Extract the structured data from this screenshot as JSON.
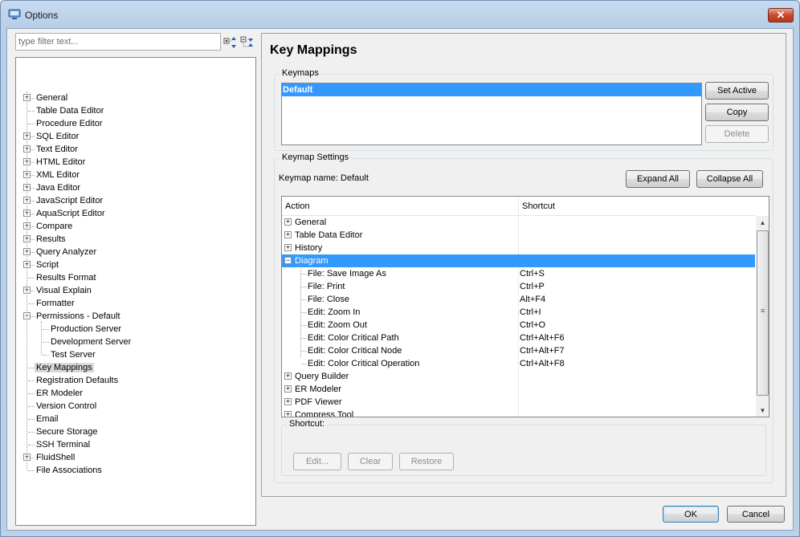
{
  "window": {
    "title": "Options"
  },
  "filter": {
    "placeholder": "type filter text..."
  },
  "tree": {
    "items": [
      {
        "label": "General",
        "expander": "+"
      },
      {
        "label": "Table Data Editor",
        "expander": ""
      },
      {
        "label": "Procedure Editor",
        "expander": ""
      },
      {
        "label": "SQL Editor",
        "expander": "+"
      },
      {
        "label": "Text Editor",
        "expander": "+"
      },
      {
        "label": "HTML Editor",
        "expander": "+"
      },
      {
        "label": "XML Editor",
        "expander": "+"
      },
      {
        "label": "Java Editor",
        "expander": "+"
      },
      {
        "label": "JavaScript Editor",
        "expander": "+"
      },
      {
        "label": "AquaScript Editor",
        "expander": "+"
      },
      {
        "label": "Compare",
        "expander": "+"
      },
      {
        "label": "Results",
        "expander": "+"
      },
      {
        "label": "Query Analyzer",
        "expander": "+"
      },
      {
        "label": "Script",
        "expander": "+"
      },
      {
        "label": "Results Format",
        "expander": ""
      },
      {
        "label": "Visual Explain",
        "expander": "+"
      },
      {
        "label": "Formatter",
        "expander": ""
      },
      {
        "label": "Permissions - Default",
        "expander": "−"
      },
      {
        "label": "Production Server",
        "expander": "",
        "child": true
      },
      {
        "label": "Development Server",
        "expander": "",
        "child": true
      },
      {
        "label": "Test Server",
        "expander": "",
        "child": true
      },
      {
        "label": "Key Mappings",
        "expander": "",
        "selected": true
      },
      {
        "label": "Registration Defaults",
        "expander": ""
      },
      {
        "label": "ER Modeler",
        "expander": ""
      },
      {
        "label": "Version Control",
        "expander": ""
      },
      {
        "label": "Email",
        "expander": ""
      },
      {
        "label": "Secure Storage",
        "expander": ""
      },
      {
        "label": "SSH Terminal",
        "expander": ""
      },
      {
        "label": "FluidShell",
        "expander": "+"
      },
      {
        "label": "File Associations",
        "expander": ""
      }
    ]
  },
  "page": {
    "title": "Key Mappings"
  },
  "keymaps": {
    "legend": "Keymaps",
    "selected": "Default",
    "set_active_label": "Set Active",
    "copy_label": "Copy",
    "delete_label": "Delete"
  },
  "settings": {
    "legend": "Keymap Settings",
    "keymap_name_text": "Keymap name: Default",
    "expand_all_label": "Expand All",
    "collapse_all_label": "Collapse All",
    "columns": {
      "action": "Action",
      "shortcut": "Shortcut"
    },
    "rows": [
      {
        "action": "General",
        "shortcut": "",
        "level": 0,
        "expander": "+"
      },
      {
        "action": "Table Data Editor",
        "shortcut": "",
        "level": 0,
        "expander": "+"
      },
      {
        "action": "History",
        "shortcut": "",
        "level": 0,
        "expander": "+"
      },
      {
        "action": "Diagram",
        "shortcut": "",
        "level": 0,
        "expander": "−",
        "selected": true
      },
      {
        "action": "File: Save Image As",
        "shortcut": "Ctrl+S",
        "level": 1
      },
      {
        "action": "File: Print",
        "shortcut": "Ctrl+P",
        "level": 1
      },
      {
        "action": "File: Close",
        "shortcut": "Alt+F4",
        "level": 1
      },
      {
        "action": "Edit: Zoom In",
        "shortcut": "Ctrl+I",
        "level": 1
      },
      {
        "action": "Edit: Zoom Out",
        "shortcut": "Ctrl+O",
        "level": 1
      },
      {
        "action": "Edit: Color Critical Path",
        "shortcut": "Ctrl+Alt+F6",
        "level": 1
      },
      {
        "action": "Edit: Color Critical Node",
        "shortcut": "Ctrl+Alt+F7",
        "level": 1
      },
      {
        "action": "Edit: Color Critical Operation",
        "shortcut": "Ctrl+Alt+F8",
        "level": 1
      },
      {
        "action": "Query Builder",
        "shortcut": "",
        "level": 0,
        "expander": "+"
      },
      {
        "action": "ER Modeler",
        "shortcut": "",
        "level": 0,
        "expander": "+"
      },
      {
        "action": "PDF Viewer",
        "shortcut": "",
        "level": 0,
        "expander": "+"
      },
      {
        "action": "Compress Tool",
        "shortcut": "",
        "level": 0,
        "expander": "+"
      }
    ]
  },
  "shortcut": {
    "legend": "Shortcut:",
    "edit_label": "Edit...",
    "clear_label": "Clear",
    "restore_label": "Restore"
  },
  "footer": {
    "ok_label": "OK",
    "cancel_label": "Cancel"
  },
  "colors": {
    "selection": "#3399ff",
    "tree_selection": "#d9d9d9"
  }
}
